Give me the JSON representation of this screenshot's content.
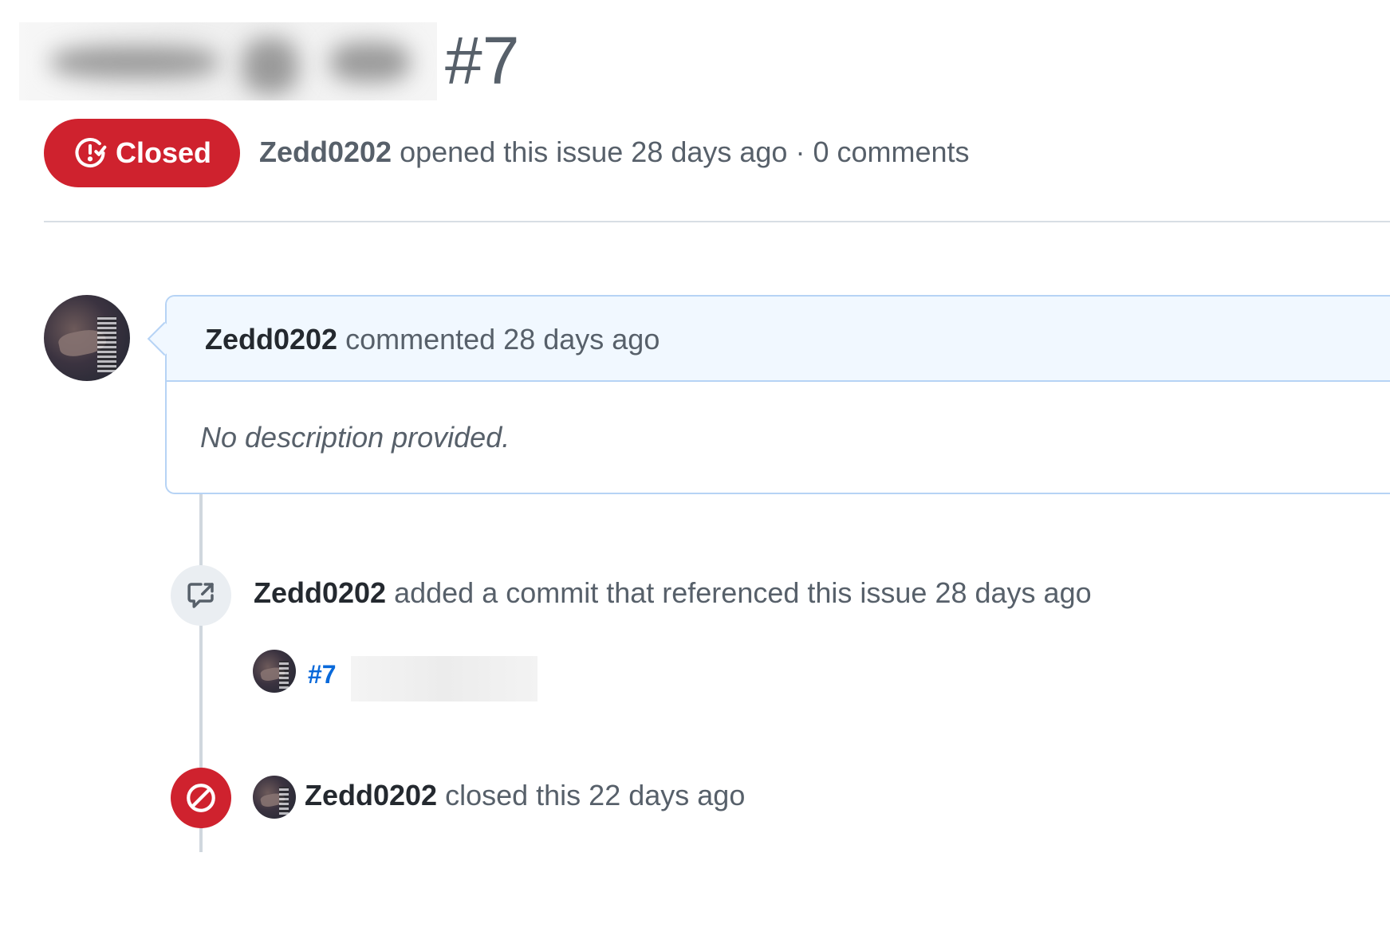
{
  "issue": {
    "number": "#7",
    "state": "Closed",
    "author": "Zedd0202",
    "opened_text": "opened this issue 28 days ago · 0 comments"
  },
  "comment": {
    "author": "Zedd0202",
    "action": "commented 28 days ago",
    "body": "No description provided."
  },
  "events": {
    "commit_reference": {
      "actor": "Zedd0202",
      "text": "added a commit that referenced this issue 28 days ago",
      "commit_label": "#7"
    },
    "closed": {
      "actor": "Zedd0202",
      "text": "closed this 22 days ago"
    }
  },
  "colors": {
    "closed_red": "#cf222e",
    "link_blue": "#0969da",
    "comment_header_bg": "#f1f8ff",
    "muted_text": "#57606a"
  },
  "icons": {
    "state": "issue-closed-icon",
    "cross_reference": "cross-reference-icon",
    "closed_event": "circle-slash-icon"
  }
}
